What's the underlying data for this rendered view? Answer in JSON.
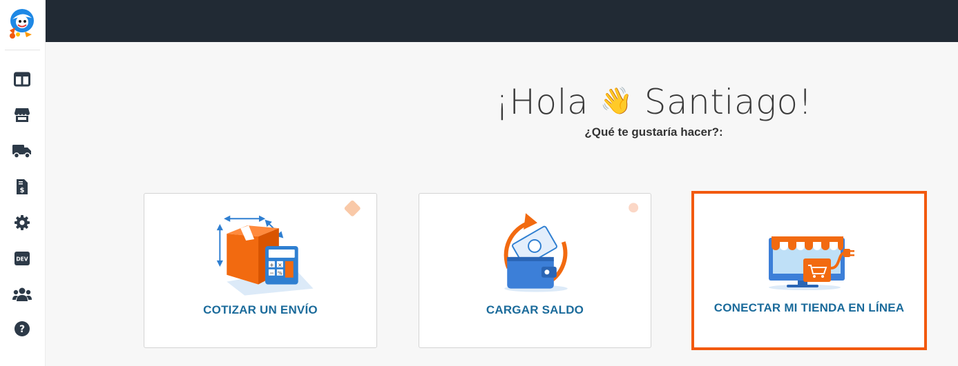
{
  "app": {
    "logo_icon": "brand-mascot-logo"
  },
  "sidebar": {
    "items": [
      {
        "icon": "dashboard-columns-icon",
        "name": "sidebar-item-dashboard"
      },
      {
        "icon": "store-icon",
        "name": "sidebar-item-stores"
      },
      {
        "icon": "truck-icon",
        "name": "sidebar-item-shipments"
      },
      {
        "icon": "invoice-dollar-icon",
        "name": "sidebar-item-billing"
      },
      {
        "icon": "gear-icon",
        "name": "sidebar-item-settings"
      },
      {
        "icon": "dev-badge-icon",
        "name": "sidebar-item-developers",
        "label": "DEV"
      },
      {
        "icon": "users-group-icon",
        "name": "sidebar-item-team"
      },
      {
        "icon": "question-circle-icon",
        "name": "sidebar-item-help"
      }
    ]
  },
  "header": {
    "greeting_prefix": "¡Hola",
    "greeting_emoji": "👋",
    "greeting_name": "Santiago!",
    "subtitle": "¿Qué te gustaría hacer?:"
  },
  "cards": [
    {
      "label": "COTIZAR UN ENVÍO",
      "icon": "box-calculator-icon",
      "selected": false
    },
    {
      "label": "CARGAR SALDO",
      "icon": "wallet-refresh-icon",
      "selected": false
    },
    {
      "label": "CONECTAR MI TIENDA EN LÍNEA",
      "icon": "online-store-plug-icon",
      "selected": true
    }
  ],
  "colors": {
    "topbar": "#212a34",
    "accent_orange": "#f2590d",
    "card_label": "#1b6b9b",
    "illustration_blue": "#4a90e2"
  }
}
